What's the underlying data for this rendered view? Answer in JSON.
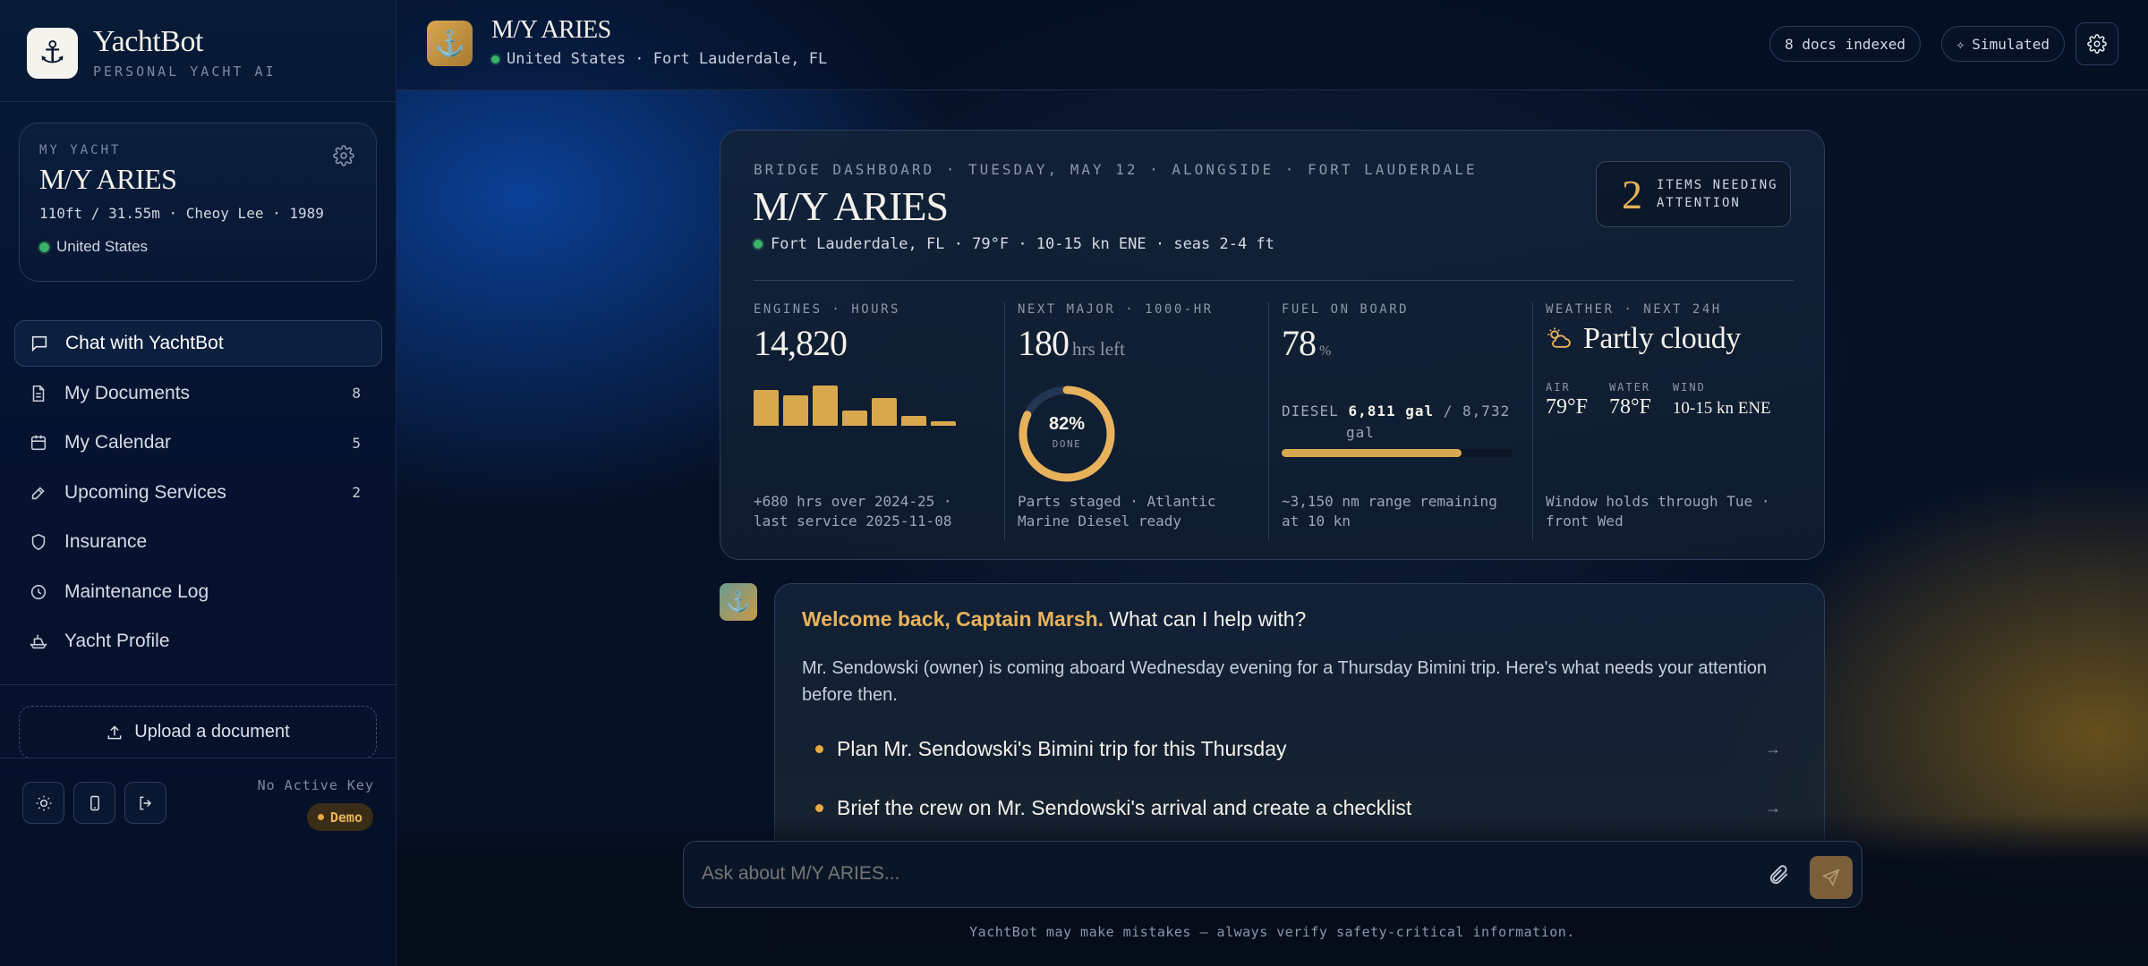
{
  "brand": {
    "name": "YachtBot",
    "tagline": "PERSONAL YACHT AI"
  },
  "yacht_card": {
    "label": "MY YACHT",
    "name": "M/Y ARIES",
    "specs": "110ft / 31.55m · Cheoy Lee · 1989",
    "country": "United States"
  },
  "nav": [
    {
      "label": "Chat with YachtBot",
      "count": ""
    },
    {
      "label": "My Documents",
      "count": "8"
    },
    {
      "label": "My Calendar",
      "count": "5"
    },
    {
      "label": "Upcoming Services",
      "count": "2"
    },
    {
      "label": "Insurance",
      "count": ""
    },
    {
      "label": "Maintenance Log",
      "count": ""
    },
    {
      "label": "Yacht Profile",
      "count": ""
    }
  ],
  "upload_label": "Upload a document",
  "key_status": "No Active Key",
  "mode_badge": "Demo",
  "topbar": {
    "yacht_name": "M/Y ARIES",
    "location": "United States · Fort Lauderdale, FL",
    "docs_indexed": "8 docs indexed",
    "mode": "Simulated"
  },
  "dashboard": {
    "eyebrow": "BRIDGE DASHBOARD · TUESDAY, MAY 12 · ALONGSIDE · FORT LAUDERDALE",
    "title": "M/Y ARIES",
    "conditions": "Fort Lauderdale, FL · 79°F · 10-15 kn ENE · seas 2-4 ft",
    "attention": {
      "count": "2",
      "line1": "ITEMS NEEDING",
      "line2": "ATTENTION"
    },
    "engines": {
      "label": "ENGINES · HOURS",
      "value": "14,820",
      "bars": [
        0.55,
        0.47,
        0.62,
        0.24,
        0.43,
        0.15,
        0.07
      ],
      "foot1": "+680 hrs over 2024-25 ·",
      "foot2": "last service 2025-11-08"
    },
    "next_major": {
      "label": "NEXT MAJOR · 1000-HR",
      "value": "180",
      "unit": "hrs left",
      "progress": 0.82,
      "progress_label": "82%",
      "progress_sub": "DONE",
      "foot1": "Parts staged · Atlantic",
      "foot2": "Marine Diesel ready"
    },
    "fuel": {
      "label": "FUEL ON BOARD",
      "value": "78",
      "unit": "%",
      "fuel_type": "DIESEL",
      "amount": "6,811 gal",
      "capacity": " / 8,732",
      "capacity_unit": "gal",
      "level": 0.78,
      "foot1": "~3,150 nm range remaining",
      "foot2": "at 10 kn"
    },
    "weather": {
      "label": "WEATHER · NEXT 24H",
      "summary": "Partly cloudy",
      "air_label": "AIR",
      "air": "79°F",
      "water_label": "WATER",
      "water": "78°F",
      "wind_label": "WIND",
      "wind": "10-15 kn ENE",
      "foot1": "Window holds through Tue ·",
      "foot2": "front Wed"
    }
  },
  "chat": {
    "greeting": "Welcome back, Captain Marsh.",
    "greeting_rest": " What can I help with?",
    "intro": "Mr. Sendowski (owner) is coming aboard Wednesday evening for a Thursday Bimini trip. Here's what needs your attention before then.",
    "suggestions": [
      "Plan Mr. Sendowski's Bimini trip for this Thursday",
      "Brief the crew on Mr. Sendowski's arrival and create a checklist"
    ]
  },
  "composer": {
    "placeholder": "Ask about M/Y ARIES..."
  },
  "disclaimer": "YachtBot may make mistakes — always verify safety-critical information.",
  "colors": {
    "accent": "#d9a84e",
    "status_green": "#3ab26a",
    "background": "#061126"
  }
}
